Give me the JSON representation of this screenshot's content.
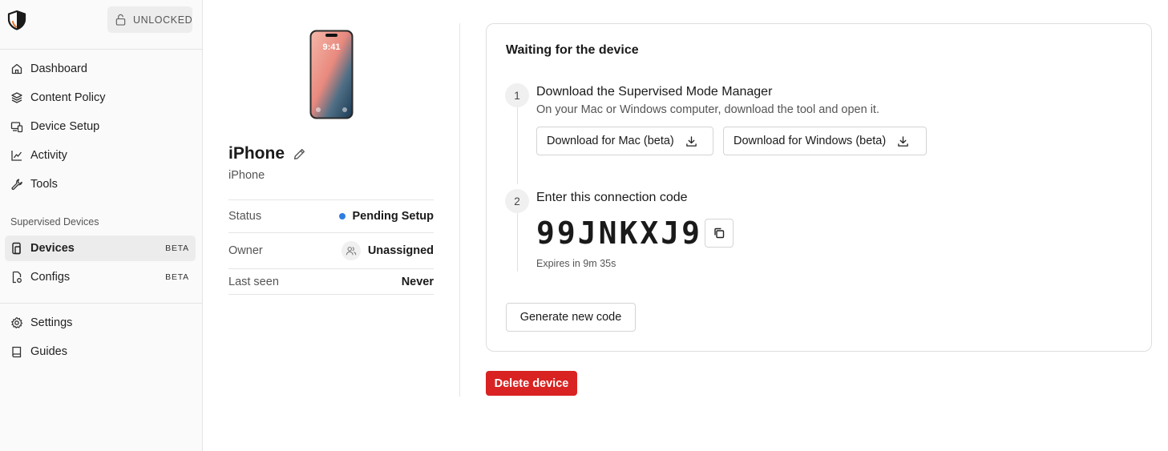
{
  "sidebar": {
    "lock_label": "UNLOCKED",
    "nav": [
      {
        "label": "Dashboard",
        "icon": "home-icon"
      },
      {
        "label": "Content Policy",
        "icon": "layers-icon"
      },
      {
        "label": "Device Setup",
        "icon": "devices-icon"
      },
      {
        "label": "Activity",
        "icon": "chart-line-icon"
      },
      {
        "label": "Tools",
        "icon": "wrench-icon"
      }
    ],
    "section_label": "Supervised Devices",
    "supervised": [
      {
        "label": "Devices",
        "badge": "BETA",
        "icon": "device-icon",
        "active": true
      },
      {
        "label": "Configs",
        "badge": "BETA",
        "icon": "config-file-icon"
      }
    ],
    "bottom": [
      {
        "label": "Settings",
        "icon": "gear-icon"
      },
      {
        "label": "Guides",
        "icon": "book-icon"
      }
    ]
  },
  "device": {
    "phone_time": "9:41",
    "name": "iPhone",
    "model": "iPhone",
    "status_label": "Status",
    "status_value": "Pending Setup",
    "status_color": "#2f7de1",
    "owner_label": "Owner",
    "owner_value": "Unassigned",
    "last_seen_label": "Last seen",
    "last_seen_value": "Never"
  },
  "card": {
    "title": "Waiting for the device",
    "step1": {
      "number": "1",
      "title": "Download the Supervised Mode Manager",
      "desc": "On your Mac or Windows computer, download the tool and open it.",
      "mac_button": "Download for Mac (beta)",
      "windows_button": "Download for Windows (beta)"
    },
    "step2": {
      "number": "2",
      "title": "Enter this connection code",
      "code": "99JNKXJ9",
      "expires": "Expires in 9m 35s"
    },
    "generate_button": "Generate new code"
  },
  "delete_button": "Delete device",
  "colors": {
    "danger": "#d92222",
    "accent": "#2f7de1"
  }
}
